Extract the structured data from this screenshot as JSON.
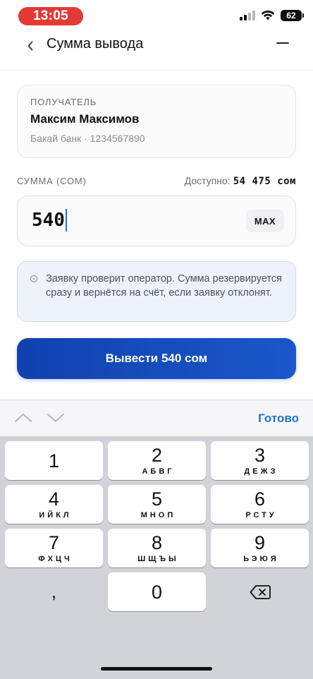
{
  "status_bar": {
    "time": "13:05",
    "battery": "62"
  },
  "header": {
    "title": "Сумма вывода"
  },
  "recipient": {
    "label": "ПОЛУЧАТЕЛЬ",
    "name": "Максим Максимов",
    "bank": "Бакай банк · 1234567890"
  },
  "amount": {
    "label": "СУММА (СОМ)",
    "available_label": "Доступно:",
    "available_value": "54 475 сом",
    "value": "540",
    "max_label": "MAX"
  },
  "notice": {
    "text": "Заявку проверит оператор. Сумма резервируется сразу и вернётся на счёт, если заявку отклонят."
  },
  "submit": {
    "label": "Вывести 540 сом"
  },
  "keyboard_accessory": {
    "done_label": "Готово"
  },
  "keyboard": {
    "keys": [
      {
        "digit": "1",
        "letters": ""
      },
      {
        "digit": "2",
        "letters": "АБВГ"
      },
      {
        "digit": "3",
        "letters": "ДЕЖЗ"
      },
      {
        "digit": "4",
        "letters": "ИЙКЛ"
      },
      {
        "digit": "5",
        "letters": "МНОП"
      },
      {
        "digit": "6",
        "letters": "РСТУ"
      },
      {
        "digit": "7",
        "letters": "ФХЦЧ"
      },
      {
        "digit": "8",
        "letters": "ШЩЪЫ"
      },
      {
        "digit": "9",
        "letters": "ЬЭЮЯ"
      },
      {
        "digit": "0",
        "letters": ""
      }
    ],
    "comma": ",",
    "delete_icon": "backspace-icon"
  },
  "colors": {
    "time_pill": "#e53935",
    "primary": "#1241b0",
    "accent_link": "#1f76c9",
    "notice_bg": "#eef3fb",
    "caret": "#1a73e8"
  }
}
